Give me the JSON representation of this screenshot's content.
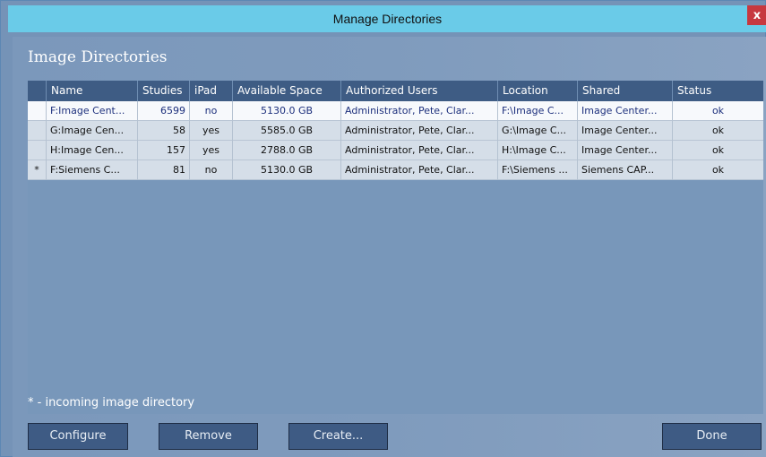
{
  "window": {
    "title": "Manage Directories",
    "close_label": "x"
  },
  "panel": {
    "header": "Image Directories"
  },
  "table": {
    "columns": [
      "",
      "Name",
      "Studies",
      "iPad",
      "Available Space",
      "Authorized Users",
      "Location",
      "Shared",
      "Status"
    ],
    "rows": [
      {
        "marker": "",
        "name": "F:Image Cent...",
        "studies": "6599",
        "ipad": "no",
        "space": "5130.0 GB",
        "users": "Administrator, Pete, Clar...",
        "location": "F:\\Image C...",
        "shared": "Image Center...",
        "status": "ok"
      },
      {
        "marker": "",
        "name": "G:Image Cen...",
        "studies": "58",
        "ipad": "yes",
        "space": "5585.0 GB",
        "users": "Administrator, Pete, Clar...",
        "location": "G:\\Image C...",
        "shared": "Image Center...",
        "status": "ok"
      },
      {
        "marker": "",
        "name": "H:Image Cen...",
        "studies": "157",
        "ipad": "yes",
        "space": "2788.0 GB",
        "users": "Administrator, Pete, Clar...",
        "location": "H:\\Image C...",
        "shared": "Image Center...",
        "status": "ok"
      },
      {
        "marker": "*",
        "name": "F:Siemens C...",
        "studies": "81",
        "ipad": "no",
        "space": "5130.0 GB",
        "users": "Administrator, Pete, Clar...",
        "location": "F:\\Siemens ...",
        "shared": "Siemens CAP...",
        "status": "ok"
      }
    ]
  },
  "footnote": "* - incoming image directory",
  "buttons": {
    "configure": "Configure",
    "remove": "Remove",
    "create": "Create...",
    "done": "Done"
  },
  "colors": {
    "titlebar": "#6acbe8",
    "header": "#3e5c84",
    "close": "#c7383f",
    "button": "#3e5b84"
  }
}
